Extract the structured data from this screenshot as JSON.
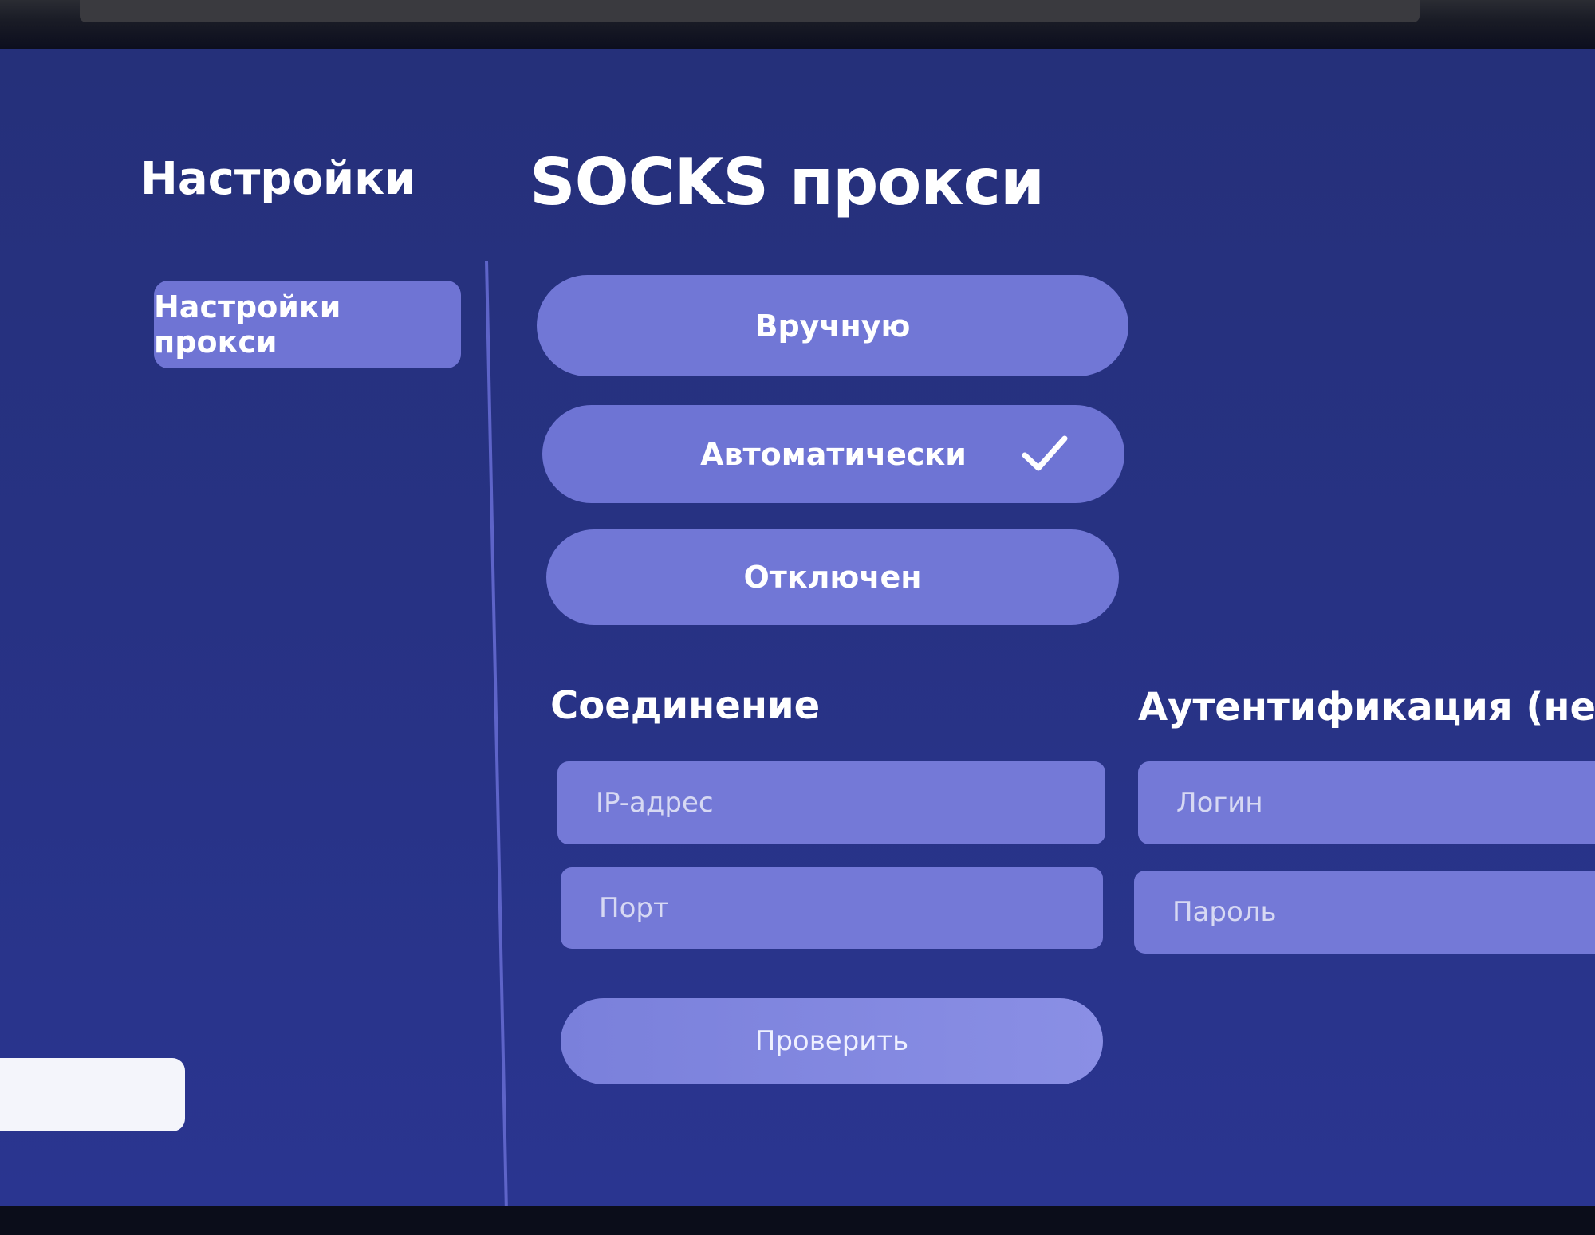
{
  "sidebar": {
    "title": "Настройки",
    "items": [
      {
        "label": "Настройки прокси"
      }
    ]
  },
  "main": {
    "title": "SOCKS прокси",
    "modes": [
      {
        "label": "Вручную",
        "selected": false
      },
      {
        "label": "Автоматически",
        "selected": true
      },
      {
        "label": "Отключен",
        "selected": false
      }
    ],
    "connection": {
      "heading": "Соединение",
      "ip_placeholder": "IP-адрес",
      "port_placeholder": "Порт"
    },
    "auth": {
      "heading": "Аутентификация (не о",
      "login_placeholder": "Логин",
      "password_placeholder": "Пароль"
    },
    "check_label": "Проверить"
  },
  "icons": {
    "selected_mode": "check-icon"
  },
  "colors": {
    "background": "#273283",
    "pill": "#7177d6",
    "text": "#ffffff"
  }
}
